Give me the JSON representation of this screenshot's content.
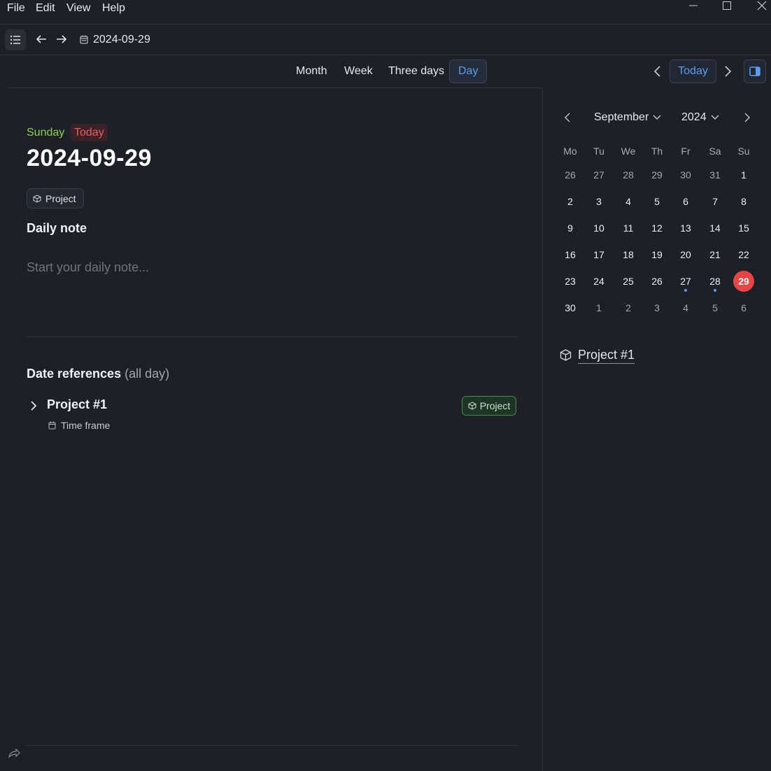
{
  "menu": [
    "File",
    "Edit",
    "View",
    "Help"
  ],
  "toolbar": {
    "current_date": "2024-09-29"
  },
  "views": {
    "tabs": [
      "Month",
      "Week",
      "Three days",
      "Day"
    ],
    "active": "Day",
    "today_label": "Today"
  },
  "day_view": {
    "weekday": "Sunday",
    "today_badge": "Today",
    "date": "2024-09-29",
    "tag": "Project",
    "note_title": "Daily note",
    "note_placeholder": "Start your daily note...",
    "refs_title": "Date references",
    "refs_suffix": "(all day)",
    "refs": [
      {
        "name": "Project #1",
        "sub": "Time frame",
        "tag": "Project"
      }
    ]
  },
  "mini_calendar": {
    "month": "September",
    "year": "2024",
    "weekdays": [
      "Mo",
      "Tu",
      "We",
      "Th",
      "Fr",
      "Sa",
      "Su"
    ],
    "weeks": [
      [
        "26",
        "27",
        "28",
        "29",
        "30",
        "31",
        "1"
      ],
      [
        "2",
        "3",
        "4",
        "5",
        "6",
        "7",
        "8"
      ],
      [
        "9",
        "10",
        "11",
        "12",
        "13",
        "14",
        "15"
      ],
      [
        "16",
        "17",
        "18",
        "19",
        "20",
        "21",
        "22"
      ],
      [
        "23",
        "24",
        "25",
        "26",
        "27",
        "28",
        "29"
      ],
      [
        "30",
        "1",
        "2",
        "3",
        "4",
        "5",
        "6"
      ]
    ],
    "selected": "29",
    "days_with_events": [
      "27",
      "28"
    ]
  },
  "side_project": "Project #1",
  "colors": {
    "accent": "#5b9cf0",
    "today": "#ef5a5a",
    "weekday": "#8fcf4f",
    "tag_green": "#3e8a4e"
  }
}
